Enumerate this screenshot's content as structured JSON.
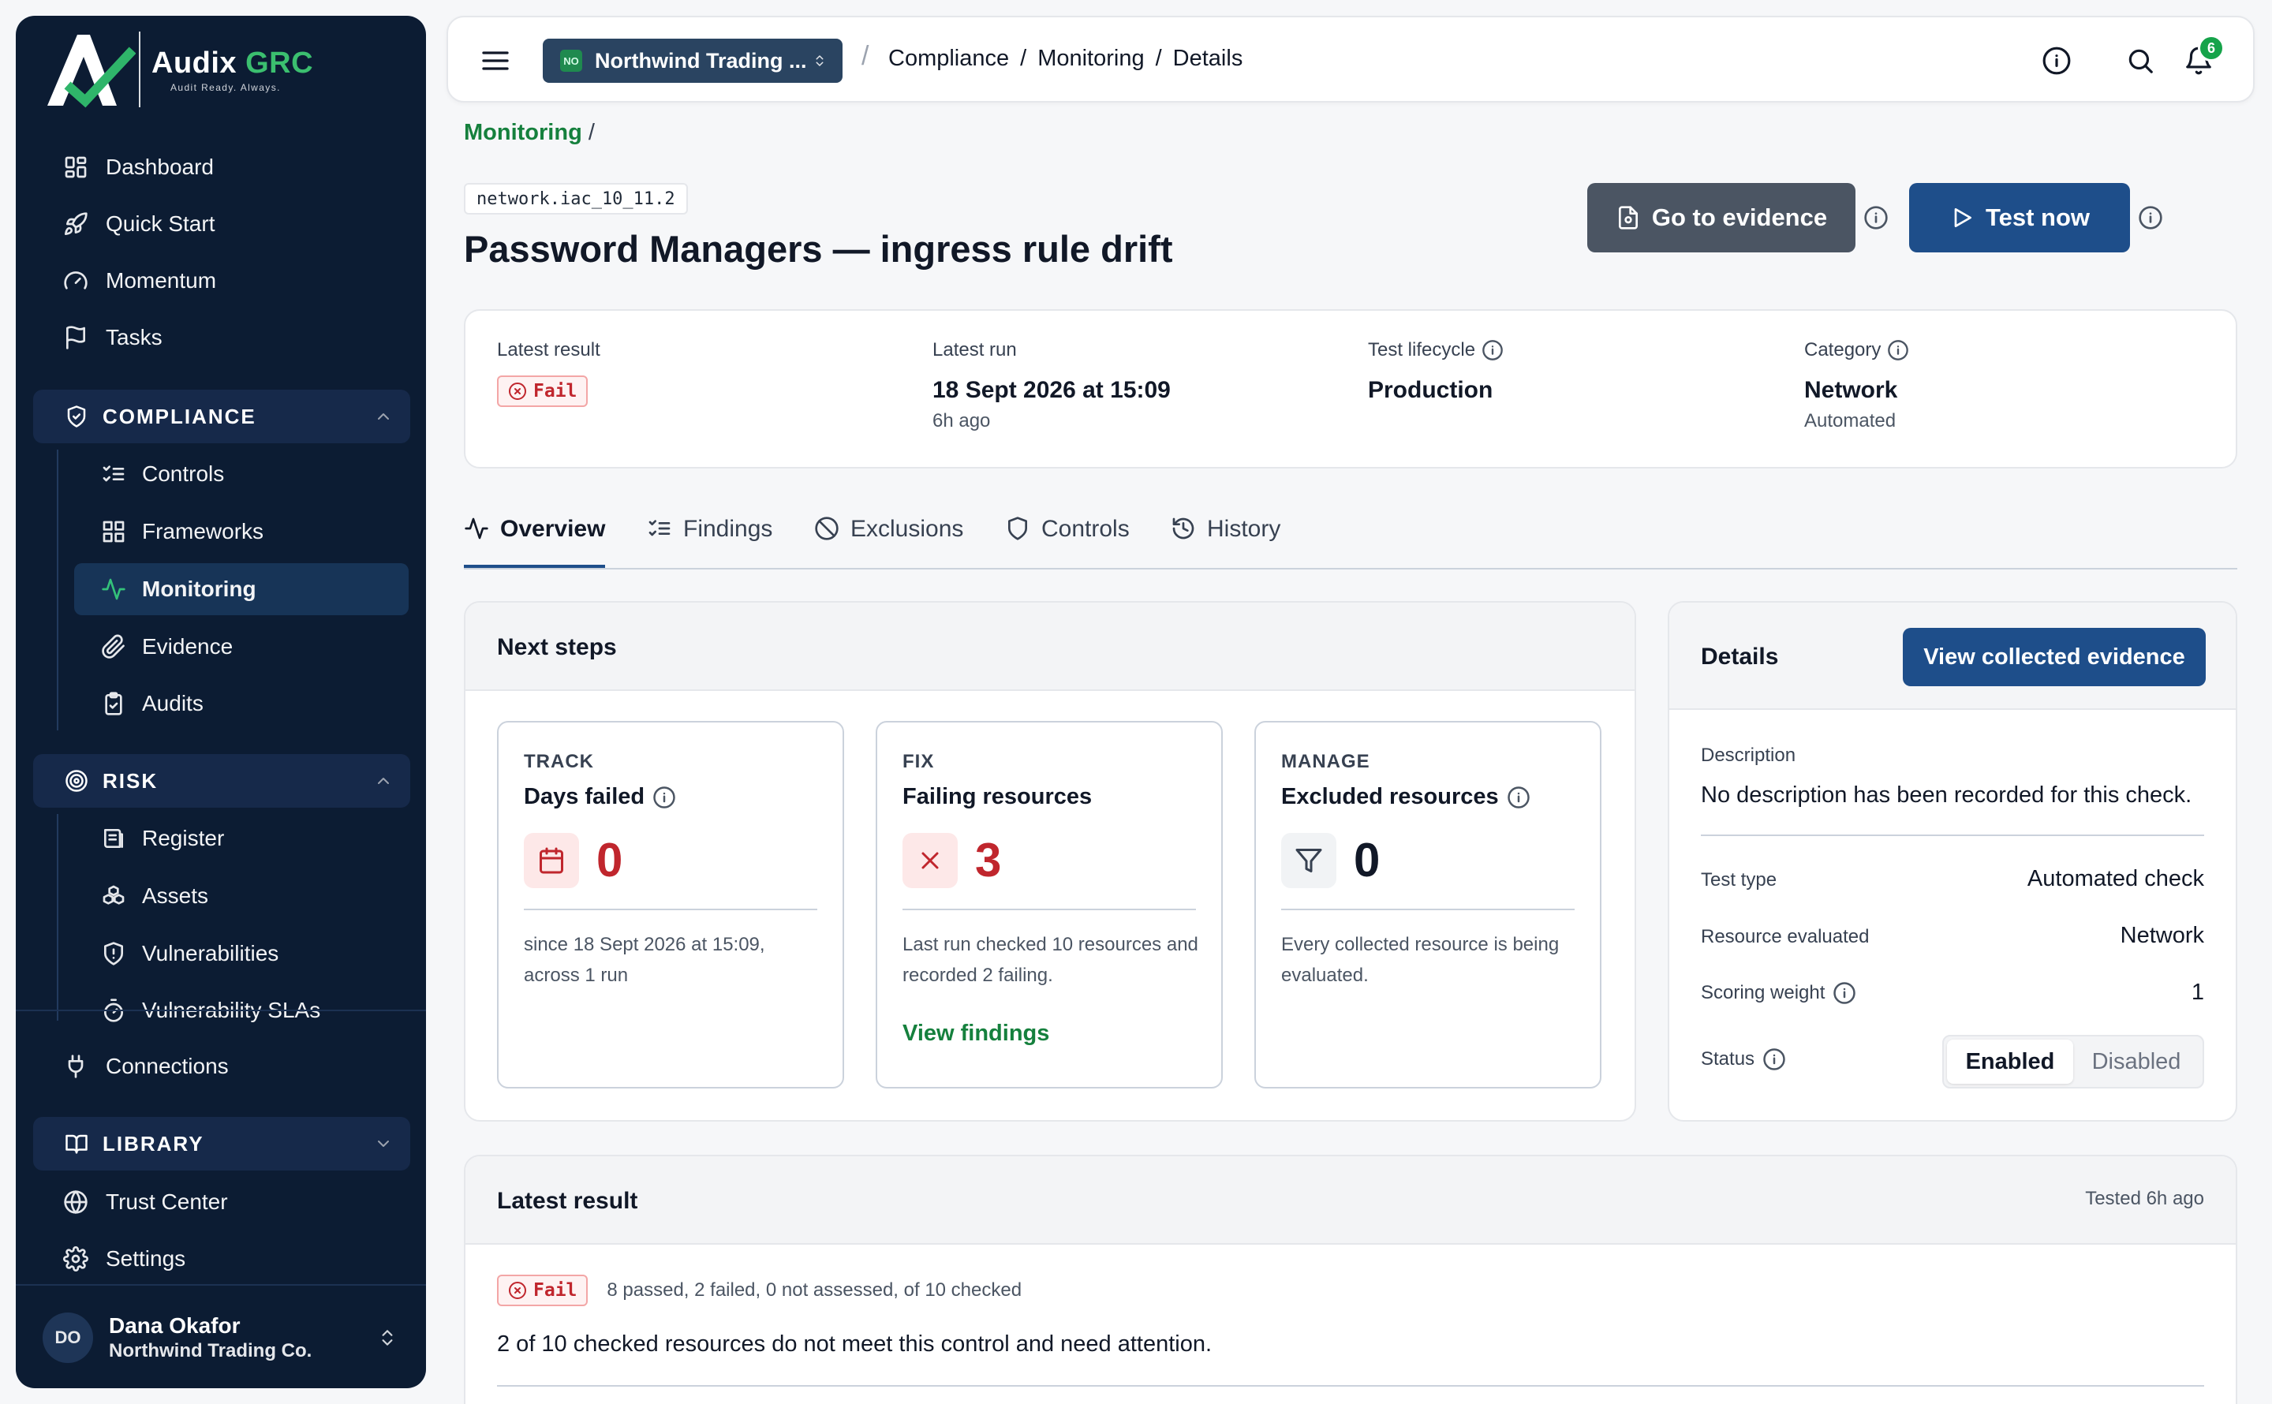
{
  "brand": {
    "name_main": "Audix",
    "name_accent": "GRC",
    "tagline": "Audit Ready. Always."
  },
  "sidebar": {
    "top_items": [
      {
        "label": "Dashboard",
        "icon": "dashboard-icon"
      },
      {
        "label": "Quick Start",
        "icon": "rocket-icon"
      },
      {
        "label": "Momentum",
        "icon": "gauge-icon"
      },
      {
        "label": "Tasks",
        "icon": "flag-icon"
      }
    ],
    "compliance": {
      "label": "COMPLIANCE",
      "items": [
        {
          "label": "Controls",
          "icon": "list-checks-icon"
        },
        {
          "label": "Frameworks",
          "icon": "grid-icon"
        },
        {
          "label": "Monitoring",
          "icon": "activity-icon",
          "active": true
        },
        {
          "label": "Evidence",
          "icon": "paperclip-icon"
        },
        {
          "label": "Audits",
          "icon": "clipboard-icon"
        }
      ]
    },
    "risk": {
      "label": "RISK",
      "items": [
        {
          "label": "Register",
          "icon": "register-icon"
        },
        {
          "label": "Assets",
          "icon": "boxes-icon"
        },
        {
          "label": "Vulnerabilities",
          "icon": "shield-alert-icon"
        },
        {
          "label": "Vulnerability SLAs",
          "icon": "timer-icon"
        }
      ]
    },
    "connections": "Connections",
    "library": {
      "label": "LIBRARY"
    },
    "bottom_items": [
      {
        "label": "Trust Center",
        "icon": "globe-icon"
      },
      {
        "label": "Settings",
        "icon": "gear-icon"
      }
    ],
    "user": {
      "initials": "DO",
      "name": "Dana Okafor",
      "org": "Northwind Trading Co."
    }
  },
  "header": {
    "org_badge": "NO",
    "org_name": "Northwind Trading ...",
    "breadcrumbs": [
      "Compliance",
      "Monitoring",
      "Details"
    ],
    "notification_count": "6"
  },
  "page": {
    "back_link": "Monitoring",
    "code": "network.iac_10_11.2",
    "title": "Password Managers — ingress rule drift",
    "go_to_evidence": "Go to evidence",
    "test_now": "Test now"
  },
  "summary": {
    "latest_result_label": "Latest result",
    "latest_result_value": "Fail",
    "latest_run_label": "Latest run",
    "latest_run_value": "18 Sept 2026 at 15:09",
    "latest_run_ago": "6h ago",
    "lifecycle_label": "Test lifecycle",
    "lifecycle_value": "Production",
    "category_label": "Category",
    "category_value": "Network",
    "category_sub": "Automated"
  },
  "tabs": [
    {
      "label": "Overview",
      "icon": "activity-icon"
    },
    {
      "label": "Findings",
      "icon": "list-checks-icon"
    },
    {
      "label": "Exclusions",
      "icon": "ban-icon"
    },
    {
      "label": "Controls",
      "icon": "shield-icon"
    },
    {
      "label": "History",
      "icon": "history-icon"
    }
  ],
  "next_steps": {
    "title": "Next steps",
    "track": {
      "kicker": "TRACK",
      "name": "Days failed",
      "value": "0",
      "desc": "since 18 Sept 2026 at 15:09, across 1 run"
    },
    "fix": {
      "kicker": "FIX",
      "name": "Failing resources",
      "value": "3",
      "desc": "Last run checked 10 resources and recorded 2 failing.",
      "link": "View findings"
    },
    "manage": {
      "kicker": "MANAGE",
      "name": "Excluded resources",
      "value": "0",
      "desc": "Every collected resource is being evaluated."
    }
  },
  "details": {
    "title": "Details",
    "view_button": "View collected evidence",
    "description_label": "Description",
    "description_value": "No description has been recorded for this check.",
    "test_type_label": "Test type",
    "test_type_value": "Automated check",
    "resource_label": "Resource evaluated",
    "resource_value": "Network",
    "weight_label": "Scoring weight",
    "weight_value": "1",
    "status_label": "Status",
    "status_options": [
      "Enabled",
      "Disabled"
    ],
    "status_selected": "Enabled"
  },
  "latest_result": {
    "title": "Latest result",
    "tested": "Tested 6h ago",
    "badge": "Fail",
    "summary": "8 passed, 2 failed, 0 not assessed, of 10 checked",
    "message": "2 of 10 checked resources do not meet this control and need attention."
  },
  "colors": {
    "sidebar_bg": "#0c1c33",
    "primary": "#1e4e8a",
    "accent_green": "#15803d",
    "fail_red": "#c0262d"
  }
}
